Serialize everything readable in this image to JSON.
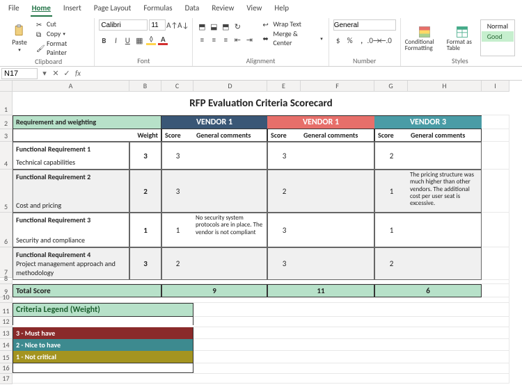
{
  "menu": {
    "file": "File",
    "home": "Home",
    "insert": "Insert",
    "page_layout": "Page Layout",
    "formulas": "Formulas",
    "data": "Data",
    "review": "Review",
    "view": "View",
    "help": "Help"
  },
  "ribbon": {
    "clipboard": {
      "label": "Clipboard",
      "paste": "Paste",
      "cut": "Cut",
      "copy": "Copy",
      "format_painter": "Format Painter"
    },
    "font": {
      "label": "Font",
      "name": "Calibri",
      "size": "11"
    },
    "alignment": {
      "label": "Alignment",
      "wrap": "Wrap Text",
      "merge": "Merge & Center"
    },
    "number": {
      "label": "Number",
      "format": "General"
    },
    "styles": {
      "label": "Styles",
      "cond": "Conditional Formatting",
      "table": "Format as Table",
      "normal": "Normal",
      "good": "Good"
    }
  },
  "fx": {
    "cell": "N17"
  },
  "cols": {
    "A": "A",
    "B": "B",
    "C": "C",
    "D": "D",
    "E": "E",
    "F": "F",
    "G": "G",
    "H": "H",
    "I": "I"
  },
  "sheet": {
    "title": "RFP Evaluation Criteria Scorecard",
    "req_header": "Requirement and weighting",
    "vendors": [
      "VENDOR 1",
      "VENDOR 1",
      "VENDOR 3"
    ],
    "sub": {
      "weight": "Weight",
      "score": "Score",
      "comments": "General comments"
    },
    "rows": [
      {
        "title": "Functional Requirement 1",
        "desc": "Technical capabilities",
        "weight": "3",
        "v": [
          [
            "3",
            ""
          ],
          [
            "3",
            ""
          ],
          [
            "2",
            ""
          ]
        ],
        "gray": false
      },
      {
        "title": "Functional Requirement 2",
        "desc": "Cost and pricing",
        "weight": "2",
        "v": [
          [
            "3",
            ""
          ],
          [
            "2",
            ""
          ],
          [
            "1",
            "The pricing structure was much higher than other vendors. The additional cost per user seat is excessive."
          ]
        ],
        "gray": true
      },
      {
        "title": "Functional Requirement 3",
        "desc": "Security and compliance",
        "weight": "1",
        "v": [
          [
            "1",
            "No security system protocols are in place. The vendor is not compliant"
          ],
          [
            "3",
            ""
          ],
          [
            "1",
            ""
          ]
        ],
        "gray": false
      },
      {
        "title": "Functional Requirement 4",
        "desc": "Project management approach and methodology",
        "weight": "3",
        "v": [
          [
            "2",
            ""
          ],
          [
            "3",
            ""
          ],
          [
            "2",
            ""
          ]
        ],
        "gray": true
      }
    ],
    "total": {
      "label": "Total Score",
      "values": [
        "9",
        "11",
        "6"
      ]
    },
    "legend": {
      "title": "Criteria Legend (Weight)",
      "items": [
        "3 - Must have",
        "2 - Nice to have",
        "1 - Not critical"
      ]
    }
  }
}
